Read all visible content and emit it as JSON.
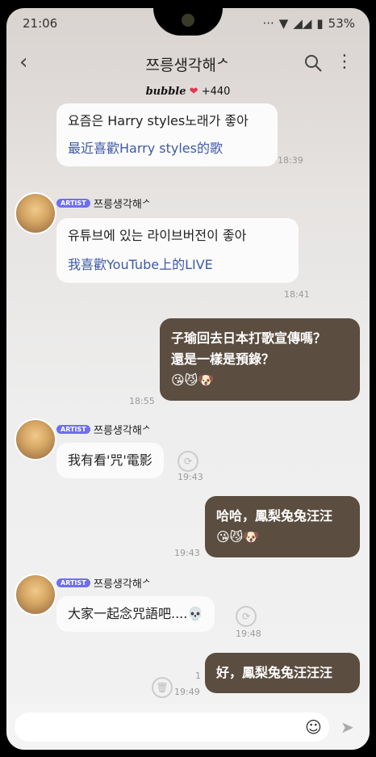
{
  "status": {
    "time": "21:06",
    "right_text": "··· ",
    "battery": "53%"
  },
  "header": {
    "title": "쯔릉생각해ᄼ",
    "bubble_brand": "bubble",
    "bubble_count": "+440"
  },
  "messages": [
    {
      "ko": "요즘은 Harry styles노래가 좋아",
      "zh": "最近喜歡Harry styles的歌",
      "time": "18:39"
    },
    {
      "sender": "쯔릉생각해ᄼ",
      "badge": "ARTIST",
      "ko": "유튜브에 있는 라이브버전이 좋아",
      "zh": "我喜歡YouTube上的LIVE",
      "time": "18:41"
    },
    {
      "out_line1": "子瑜回去日本打歌宣傳嗎？",
      "out_line2": "還是一樣是預錄？",
      "out_emoji": "😘😼🐶",
      "time": "18:55"
    },
    {
      "sender": "쯔릉생각해ᄼ",
      "badge": "ARTIST",
      "text": "我有看'咒'電影",
      "time": "19:43"
    },
    {
      "out_line1": "哈哈，鳳梨兔兔汪汪",
      "out_emoji": "😘😼🐶",
      "time": "19:43"
    },
    {
      "sender": "쯔릉생각해ᄼ",
      "badge": "ARTIST",
      "text": "大家一起念咒語吧....💀",
      "time": "19:48"
    },
    {
      "out_line1": "好，鳳梨兔兔汪汪汪",
      "unread": "1",
      "time": "19:49"
    }
  ]
}
